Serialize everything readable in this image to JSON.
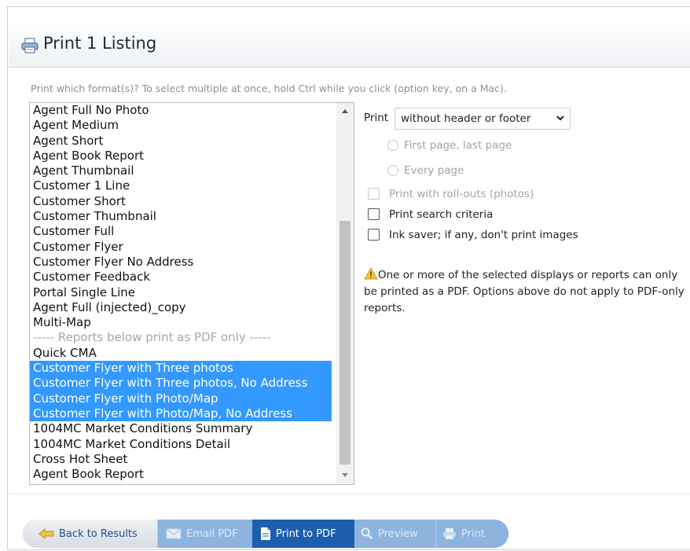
{
  "header": {
    "title": "Print 1 Listing",
    "icon": "printer-icon"
  },
  "instructions": "Print which format(s)? To select multiple at once, hold Ctrl while you click (option key, on a Mac).",
  "formats": [
    {
      "label": "Agent Full No Photo",
      "selected": false
    },
    {
      "label": "Agent Medium",
      "selected": false
    },
    {
      "label": "Agent Short",
      "selected": false
    },
    {
      "label": "Agent Book Report",
      "selected": false
    },
    {
      "label": "Agent Thumbnail",
      "selected": false
    },
    {
      "label": "Customer 1 Line",
      "selected": false
    },
    {
      "label": "Customer Short",
      "selected": false
    },
    {
      "label": "Customer Thumbnail",
      "selected": false
    },
    {
      "label": "Customer Full",
      "selected": false
    },
    {
      "label": "Customer Flyer",
      "selected": false
    },
    {
      "label": "Customer Flyer No Address",
      "selected": false
    },
    {
      "label": "Customer Feedback",
      "selected": false
    },
    {
      "label": "Portal Single Line",
      "selected": false
    },
    {
      "label": "Agent Full (injected)_copy",
      "selected": false
    },
    {
      "label": "Multi-Map",
      "selected": false
    },
    {
      "label": "----- Reports below print as PDF only -----",
      "selected": false,
      "separator": true
    },
    {
      "label": "Quick CMA",
      "selected": false
    },
    {
      "label": "Customer Flyer with Three photos",
      "selected": true
    },
    {
      "label": "Customer Flyer with Three photos, No Address",
      "selected": true
    },
    {
      "label": "Customer Flyer with Photo/Map",
      "selected": true
    },
    {
      "label": "Customer Flyer with Photo/Map, No Address",
      "selected": true
    },
    {
      "label": "1004MC Market Conditions Summary",
      "selected": false
    },
    {
      "label": "1004MC Market Conditions Detail",
      "selected": false
    },
    {
      "label": "Cross Hot Sheet",
      "selected": false
    },
    {
      "label": "Agent Book Report",
      "selected": false
    }
  ],
  "options": {
    "print_label": "Print",
    "header_select": "without header or footer",
    "radio_first_last": "First page, last page",
    "radio_every": "Every page",
    "rollouts": "Print with roll-outs (photos)",
    "search_criteria": "Print search criteria",
    "ink_saver": "Ink saver; if any, don't print images"
  },
  "warning": "One or more of the selected displays or reports can only be printed as a PDF. Options above do not apply to PDF-only reports.",
  "buttons": {
    "back": "Back to Results",
    "email": "Email PDF",
    "print_pdf": "Print to PDF",
    "preview": "Preview",
    "print": "Print"
  },
  "colors": {
    "selection": "#3399ff",
    "primary_button": "#1d5fae",
    "disabled_button": "#8db4de"
  }
}
